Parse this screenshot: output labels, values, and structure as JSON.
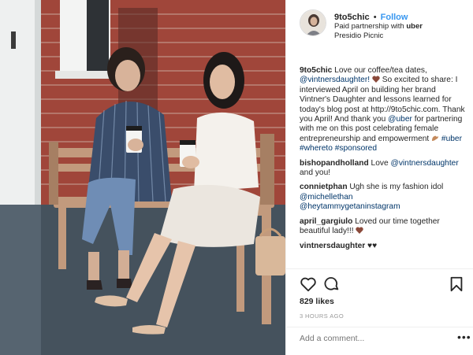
{
  "header": {
    "username": "9to5chic",
    "separator": "•",
    "follow_label": "Follow",
    "paid_prefix": "Paid partnership with",
    "partner": "uber",
    "location": "Presidio Picnic"
  },
  "caption": {
    "username": "9to5chic",
    "t1": " Love our coffee/tea dates, ",
    "mention": "@vintnersdaughter!",
    "t2": " So excited to share: I interviewed April on building her brand Vintner's Daughter and lessons learned for today's blog post at http://9to5chic.com. Thank you April! And thank you ",
    "mention2": "@uber",
    "t3": " for partnering with me on this post celebrating female entrepreneurship and empowerment ",
    "hashtags": "#uber #whereto #sponsored"
  },
  "comments": [
    {
      "user": "bishopandholland",
      "text": " Love ",
      "mention": "@vintnersdaughter",
      "after": " and you!"
    },
    {
      "user": "connietphan",
      "text": " Ugh she is my fashion idol ",
      "mention": "@michellethan",
      "mention2": "@heytammygetaninstagram"
    },
    {
      "user": "april_gargiulo",
      "text": " Loved our time together beautiful lady!!!"
    },
    {
      "user": "vintnersdaughter",
      "text": " ♥♥"
    }
  ],
  "likes": "829 likes",
  "timestamp": "3 HOURS AGO",
  "add_comment_placeholder": "Add a comment...",
  "more_label": "•••",
  "colors": {
    "link": "#3897f0",
    "mention": "#003569",
    "heart": "#8b4a3b",
    "muted": "#999999"
  }
}
